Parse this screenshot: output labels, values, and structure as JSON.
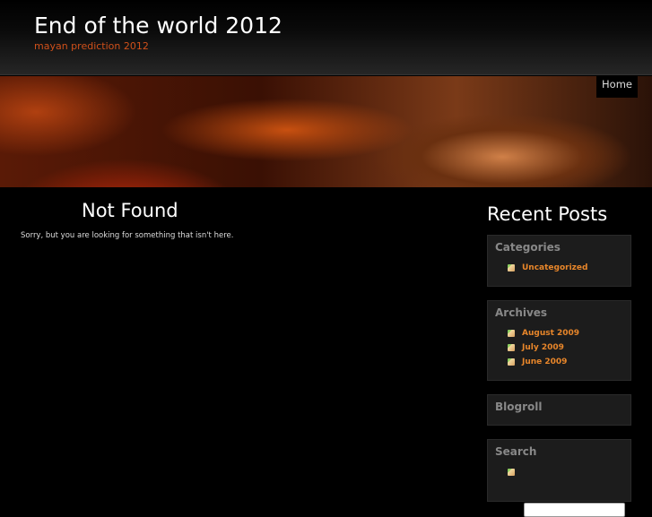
{
  "header": {
    "title": "End of the world 2012",
    "tagline": "mayan prediction 2012"
  },
  "nav": {
    "home": "Home"
  },
  "main": {
    "title": "Not Found",
    "message": "Sorry, but you are looking for something that isn't here."
  },
  "sidebar": {
    "recent_posts": "Recent Posts",
    "categories": {
      "title": "Categories",
      "items": [
        "Uncategorized"
      ]
    },
    "archives": {
      "title": "Archives",
      "items": [
        "August 2009",
        "July 2009",
        "June 2009"
      ]
    },
    "blogroll": {
      "title": "Blogroll"
    },
    "search": {
      "title": "Search",
      "value": ""
    }
  }
}
